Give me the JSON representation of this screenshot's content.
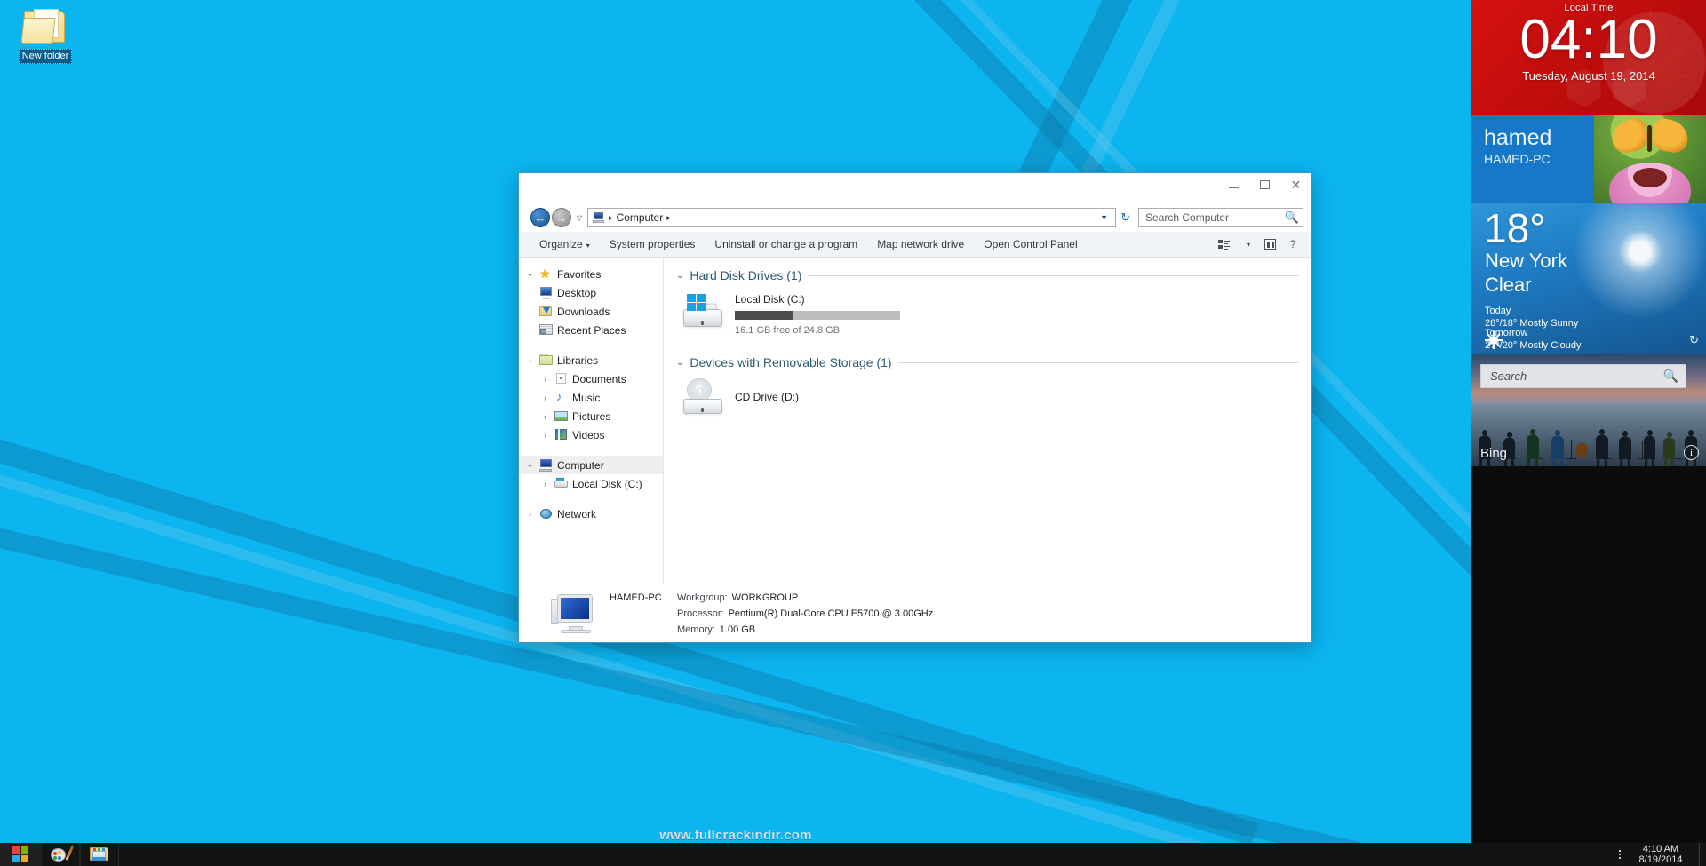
{
  "desktop": {
    "icon": {
      "label": "New folder",
      "icon": "folder-icon"
    },
    "watermark": "www.fullcrackindir.com"
  },
  "explorer": {
    "window_controls": {
      "minimize": "–",
      "maximize": "□",
      "close": "✕"
    },
    "nav": {
      "back": "←",
      "forward": "→",
      "recent_caret": "▽",
      "dropdown_caret": "▼",
      "refresh": "↻"
    },
    "breadcrumb": {
      "pc_icon": "computer-icon",
      "sep1": "▸",
      "label": "Computer",
      "sep2": "▸"
    },
    "search": {
      "placeholder": "Search Computer",
      "icon": "search-icon"
    },
    "toolbar": {
      "organize": "Organize",
      "organize_caret": "▾",
      "system_properties": "System properties",
      "uninstall": "Uninstall or change a program",
      "map_network_drive": "Map network drive",
      "open_control_panel": "Open Control Panel",
      "view_caret": "▾",
      "help": "?"
    },
    "sidebar": [
      {
        "label": "Favorites",
        "icon": "star-icon",
        "chevron": "⌄",
        "level": 0,
        "selected": false
      },
      {
        "label": "Desktop",
        "icon": "desktop-icon",
        "chevron": "",
        "level": 1,
        "selected": false
      },
      {
        "label": "Downloads",
        "icon": "downloads-icon",
        "chevron": "",
        "level": 1,
        "selected": false
      },
      {
        "label": "Recent Places",
        "icon": "recent-places-icon",
        "chevron": "",
        "level": 1,
        "selected": false
      },
      {
        "label": "Libraries",
        "icon": "libraries-icon",
        "chevron": "⌄",
        "level": 0,
        "selected": false
      },
      {
        "label": "Documents",
        "icon": "documents-icon",
        "chevron": "›",
        "level": 1,
        "selected": false
      },
      {
        "label": "Music",
        "icon": "music-icon",
        "chevron": "›",
        "level": 1,
        "selected": false
      },
      {
        "label": "Pictures",
        "icon": "pictures-icon",
        "chevron": "›",
        "level": 1,
        "selected": false
      },
      {
        "label": "Videos",
        "icon": "videos-icon",
        "chevron": "›",
        "level": 1,
        "selected": false
      },
      {
        "label": "Computer",
        "icon": "computer-icon",
        "chevron": "⌄",
        "level": 0,
        "selected": true
      },
      {
        "label": "Local Disk (C:)",
        "icon": "harddisk-icon",
        "chevron": "›",
        "level": 1,
        "selected": false
      },
      {
        "label": "Network",
        "icon": "network-icon",
        "chevron": "›",
        "level": 0,
        "selected": false
      }
    ],
    "groups": [
      {
        "title": "Hard Disk Drives (1)",
        "chevron": "⌄",
        "items": [
          {
            "name": "Local Disk (C:)",
            "icon": "harddisk-windows-icon",
            "free_text": "16.1 GB free of 24.8 GB",
            "used_percent": 35
          }
        ]
      },
      {
        "title": "Devices with Removable Storage (1)",
        "chevron": "⌄",
        "items": [
          {
            "name": "CD Drive (D:)",
            "icon": "cd-drive-icon",
            "free_text": "",
            "used_percent": 0
          }
        ]
      }
    ],
    "details": {
      "icon": "computer-details-icon",
      "pc_name": "HAMED-PC",
      "workgroup_key": "Workgroup:",
      "workgroup_value": "WORKGROUP",
      "processor_key": "Processor:",
      "processor_value": "Pentium(R) Dual-Core  CPU     E5700  @ 3.00GHz",
      "memory_key": "Memory:",
      "memory_value": "1.00 GB"
    }
  },
  "sidebar_gadgets": {
    "clock": {
      "header": "Local Time",
      "time": "04:10",
      "date": "Tuesday, August 19, 2014"
    },
    "user": {
      "name": "hamed",
      "pc": "HAMED-PC"
    },
    "weather": {
      "temperature": "18°",
      "city": "New York",
      "condition": "Clear",
      "today_label": "Today",
      "today_detail": "28°/18° Mostly Sunny",
      "tomorrow_label": "Tomorrow",
      "tomorrow_detail": "27°/20° Mostly Cloudy",
      "sun_icon": "sun-icon",
      "refresh_icon": "refresh-icon"
    },
    "bing": {
      "placeholder": "Search",
      "label": "Bing",
      "search_icon": "search-icon",
      "info_icon": "info-icon"
    }
  },
  "taskbar": {
    "start": "start-button",
    "apps": [
      {
        "name": "paint-icon"
      },
      {
        "name": "file-explorer-icon"
      }
    ],
    "tray": {
      "overflow": "tray-overflow-icon",
      "time": "4:10 AM",
      "date": "8/19/2014"
    }
  }
}
